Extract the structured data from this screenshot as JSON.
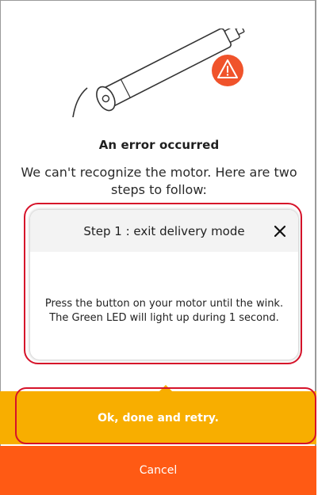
{
  "error": {
    "title": "An error occurred",
    "message": "We can't recognize the motor. Here are two steps to follow:"
  },
  "step": {
    "title": "Step 1 : exit delivery mode",
    "body_line1": "Press the button on your motor until the wink.",
    "body_line2": "The Green LED will light up during 1 second."
  },
  "actions": {
    "retry_label": "Ok, done and retry.",
    "cancel_label": "Cancel"
  },
  "icons": {
    "warning": "warning-icon",
    "close": "close-icon",
    "illustration": "motor-illustration"
  },
  "colors": {
    "warning_badge": "#f0532b",
    "retry_background": "#f8ae00",
    "cancel_background": "#ff5a14",
    "highlight_outline": "#d6132a"
  }
}
